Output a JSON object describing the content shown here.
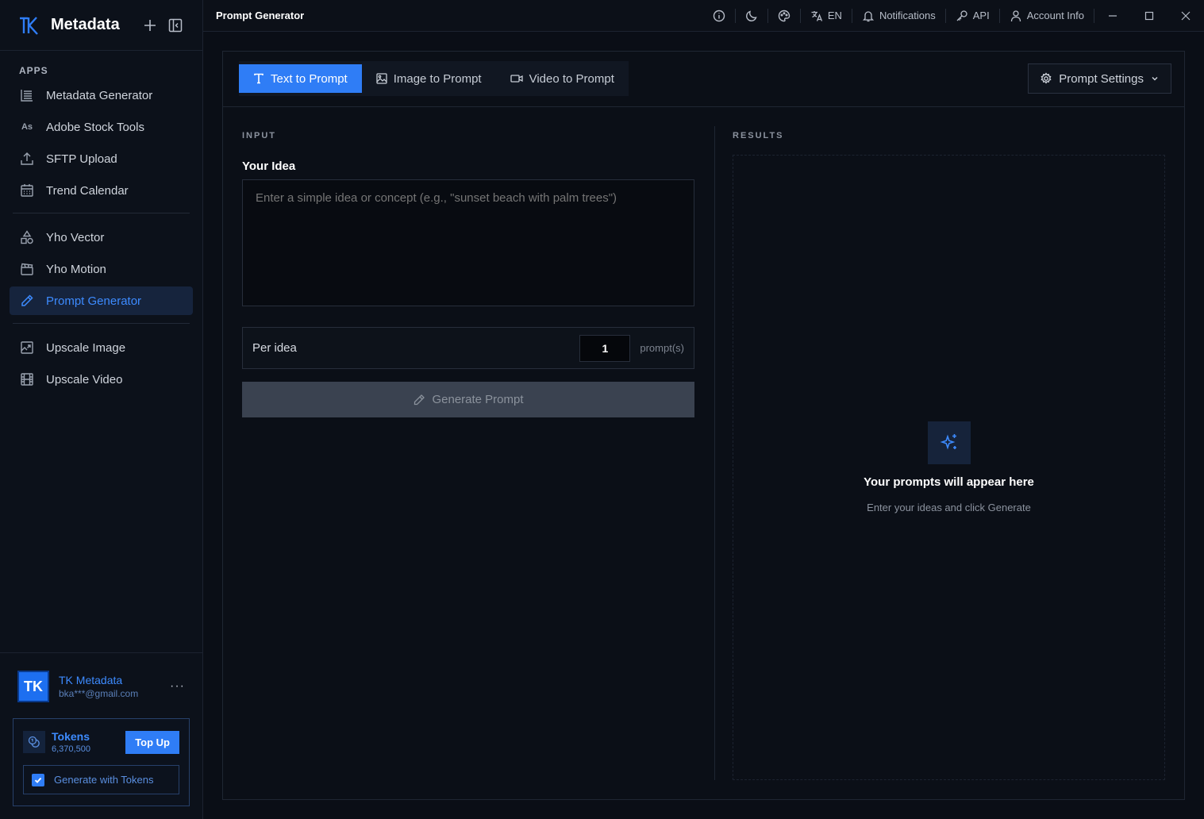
{
  "window": {
    "title": "Prompt Generator"
  },
  "sidebar": {
    "app_name": "Metadata",
    "section_label": "APPS",
    "groups": [
      [
        {
          "label": "Metadata Generator",
          "icon": "list-icon"
        },
        {
          "label": "Adobe Stock Tools",
          "icon": "adobe-stock-icon",
          "icon_text": "As"
        },
        {
          "label": "SFTP Upload",
          "icon": "upload-icon"
        },
        {
          "label": "Trend Calendar",
          "icon": "calendar-icon"
        }
      ],
      [
        {
          "label": "Yho Vector",
          "icon": "shapes-icon"
        },
        {
          "label": "Yho Motion",
          "icon": "clapperboard-icon"
        },
        {
          "label": "Prompt Generator",
          "icon": "pencil-icon",
          "active": true
        }
      ],
      [
        {
          "label": "Upscale Image",
          "icon": "image-upscale-icon"
        },
        {
          "label": "Upscale Video",
          "icon": "film-icon"
        }
      ]
    ],
    "user": {
      "initials": "TK",
      "name": "TK Metadata",
      "email": "bka***@gmail.com",
      "more": "···"
    },
    "tokens": {
      "label": "Tokens",
      "amount": "6,370,500",
      "topup": "Top Up",
      "generate_with_tokens": "Generate with Tokens",
      "checked": true
    }
  },
  "topbar": {
    "language": "EN",
    "notifications": "Notifications",
    "api": "API",
    "account": "Account Info"
  },
  "main": {
    "tabs": [
      {
        "label": "Text to Prompt",
        "icon": "text-icon",
        "active": true
      },
      {
        "label": "Image to Prompt",
        "icon": "image-icon"
      },
      {
        "label": "Video to Prompt",
        "icon": "video-icon"
      }
    ],
    "settings_label": "Prompt Settings",
    "input": {
      "section_label": "INPUT",
      "idea_label": "Your Idea",
      "idea_placeholder": "Enter a simple idea or concept (e.g., \"sunset beach with palm trees\")",
      "idea_value": "",
      "per_idea_label": "Per idea",
      "per_idea_value": "1",
      "per_idea_unit": "prompt(s)",
      "generate_label": "Generate Prompt"
    },
    "results": {
      "section_label": "RESULTS",
      "empty_title": "Your prompts will appear here",
      "empty_subtitle": "Enter your ideas and click Generate"
    }
  },
  "colors": {
    "accent": "#2f7df6",
    "background": "#0a0e16",
    "active_nav_bg": "#16243d"
  }
}
